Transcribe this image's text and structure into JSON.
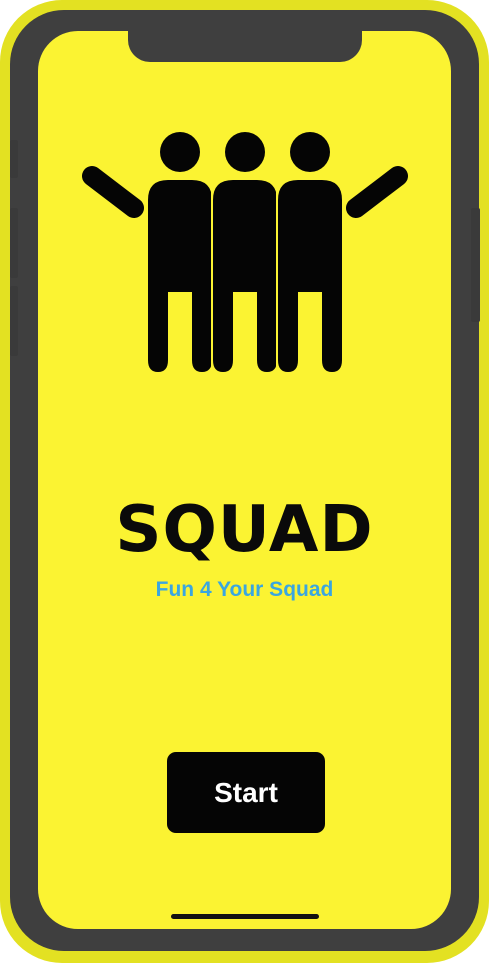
{
  "app": {
    "title": "SQUAD",
    "tagline": "Fun 4 Your Squad",
    "logo_icon": "squad-people-icon"
  },
  "actions": {
    "start_label": "Start"
  },
  "colors": {
    "background": "#fbf332",
    "device_frame": "#3f3f3f",
    "device_shell": "#e3e122",
    "title": "#0a0a0a",
    "tagline": "#3aa6e0",
    "button_bg": "#050505",
    "button_text": "#ffffff"
  }
}
